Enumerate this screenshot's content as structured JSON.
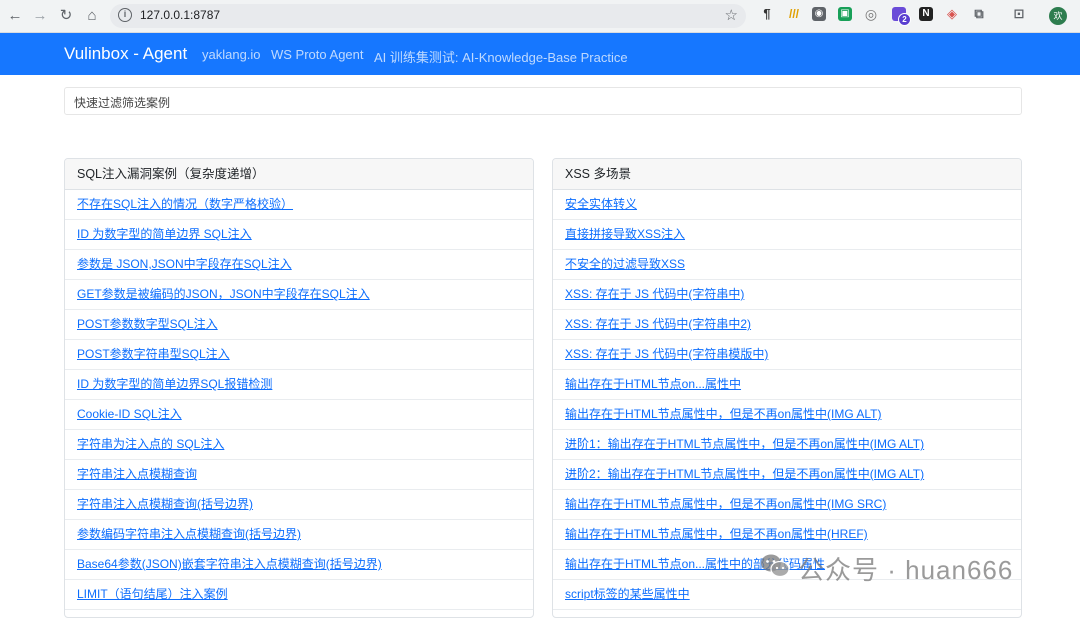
{
  "browser": {
    "url": "127.0.0.1:8787",
    "profile_initial": "欢",
    "extension_badge": "2"
  },
  "navbar": {
    "brand": "Vulinbox - Agent",
    "links": [
      "yaklang.io",
      "WS Proto Agent",
      "AI 训练集测试: AI-Knowledge-Base Practice"
    ]
  },
  "filter": {
    "placeholder": "快速过滤筛选案例"
  },
  "sql_card": {
    "title": "SQL注入漏洞案例（复杂度递增）",
    "items": [
      "不存在SQL注入的情况（数字严格校验）",
      "ID 为数字型的简单边界 SQL注入",
      "参数是 JSON,JSON中字段存在SQL注入",
      "GET参数是被编码的JSON，JSON中字段存在SQL注入",
      "POST参数数字型SQL注入",
      "POST参数字符串型SQL注入",
      "ID 为数字型的简单边界SQL报错检测",
      "Cookie-ID SQL注入",
      "字符串为注入点的 SQL注入",
      "字符串注入点模糊查询",
      "字符串注入点模糊查询(括号边界)",
      "参数编码字符串注入点模糊查询(括号边界)",
      "Base64参数(JSON)嵌套字符串注入点模糊查询(括号边界)",
      "LIMIT（语句结尾）注入案例"
    ]
  },
  "xss_card": {
    "title": "XSS 多场景",
    "items": [
      "安全实体转义",
      "直接拼接导致XSS注入",
      "不安全的过滤导致XSS",
      "XSS: 存在于 JS 代码中(字符串中)",
      "XSS: 存在于 JS 代码中(字符串中2)",
      "XSS: 存在于 JS 代码中(字符串模版中)",
      "输出存在于HTML节点on...属性中",
      "输出存在于HTML节点属性中，但是不再on属性中(IMG ALT)",
      "进阶1：输出存在于HTML节点属性中，但是不再on属性中(IMG ALT)",
      "进阶2：输出存在于HTML节点属性中，但是不再on属性中(IMG ALT)",
      "输出存在于HTML节点属性中，但是不再on属性中(IMG SRC)",
      "输出存在于HTML节点属性中，但是不再on属性中(HREF)",
      "输出存在于HTML节点on...属性中的部分代码属性",
      "script标签的某些属性中"
    ]
  },
  "watermark": {
    "text": "公众号 · huan666"
  },
  "colors": {
    "navbar": "#1677ff",
    "link": "#0d6efd"
  }
}
